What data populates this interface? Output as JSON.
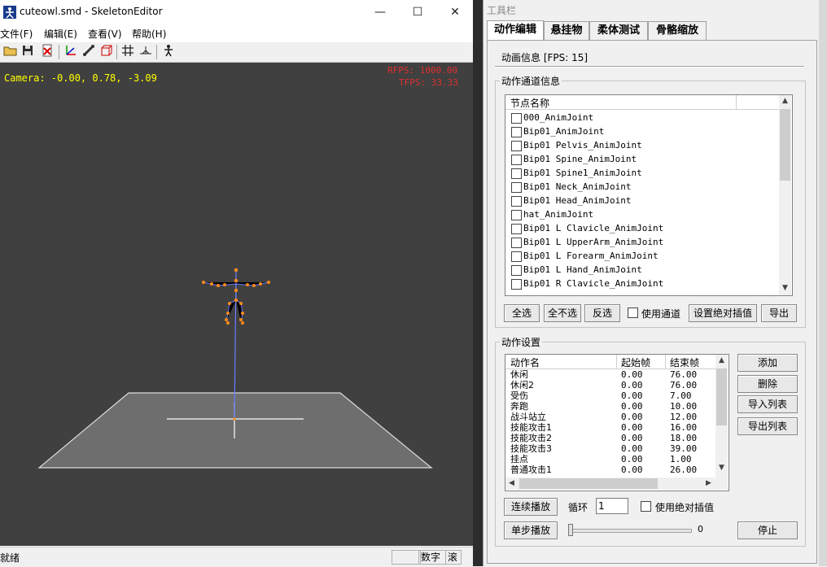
{
  "main_window": {
    "title": "cuteowl.smd - SkeletonEditor",
    "minimize_glyph": "—",
    "maximize_glyph": "☐",
    "close_glyph": "✕",
    "menu": [
      "文件(F)",
      "编辑(E)",
      "查看(V)",
      "帮助(H)"
    ],
    "toolbar_icons": [
      "open-folder-icon",
      "save-icon",
      "close-file-icon",
      "axis-icon",
      "bone-icon",
      "box-icon",
      "grid-icon",
      "ground-icon",
      "figure-icon"
    ],
    "viewport": {
      "camera": "Camera: -0.00, 0.78, -3.09",
      "rfps": "RFPS: 1000.00",
      "tfps": "TFPS: 33.33",
      "background_color": "#404040",
      "floor_color": "#6e6e6e",
      "bone_color": "#5c6cff",
      "joint_color": "#ff8c1a"
    },
    "status": {
      "ready": "就绪",
      "num": "数字",
      "scroll": "滚"
    }
  },
  "tool_panel": {
    "title": "工具栏",
    "tabs": [
      "动作编辑",
      "悬挂物",
      "柔体测试",
      "骨骼缩放"
    ],
    "anim_info": "动画信息 [FPS: 15]",
    "channel_group": {
      "label": "动作通道信息",
      "column": "节点名称",
      "nodes": [
        "000_AnimJoint",
        "Bip01_AnimJoint",
        "Bip01 Pelvis_AnimJoint",
        "Bip01 Spine_AnimJoint",
        "Bip01 Spine1_AnimJoint",
        "Bip01 Neck_AnimJoint",
        "Bip01 Head_AnimJoint",
        "hat_AnimJoint",
        "Bip01 L Clavicle_AnimJoint",
        "Bip01 L UpperArm_AnimJoint",
        "Bip01 L Forearm_AnimJoint",
        "Bip01 L Hand_AnimJoint",
        "Bip01 R Clavicle_AnimJoint"
      ],
      "buttons": {
        "select_all": "全选",
        "select_none": "全不选",
        "invert": "反选",
        "use_channel": "使用通道",
        "set_absolute": "设置绝对插值",
        "export": "导出"
      }
    },
    "action_group": {
      "label": "动作设置",
      "columns": [
        "动作名",
        "起始帧",
        "结束帧"
      ],
      "rows": [
        [
          "休闲",
          "0.00",
          "76.00"
        ],
        [
          "休闲2",
          "0.00",
          "76.00"
        ],
        [
          "受伤",
          "0.00",
          "7.00"
        ],
        [
          "奔跑",
          "0.00",
          "10.00"
        ],
        [
          "战斗站立",
          "0.00",
          "12.00"
        ],
        [
          "技能攻击1",
          "0.00",
          "16.00"
        ],
        [
          "技能攻击2",
          "0.00",
          "18.00"
        ],
        [
          "技能攻击3",
          "0.00",
          "39.00"
        ],
        [
          "挂点",
          "0.00",
          "1.00"
        ],
        [
          "普通攻击1",
          "0.00",
          "26.00"
        ]
      ],
      "side_buttons": [
        "添加",
        "删除",
        "导入列表",
        "导出列表"
      ],
      "continuous_play": "连续播放",
      "loop_label": "循环",
      "loop_value": "1",
      "use_absolute": "使用绝对插值",
      "step_play": "单步播放",
      "slider_value": "0",
      "stop": "停止"
    }
  }
}
